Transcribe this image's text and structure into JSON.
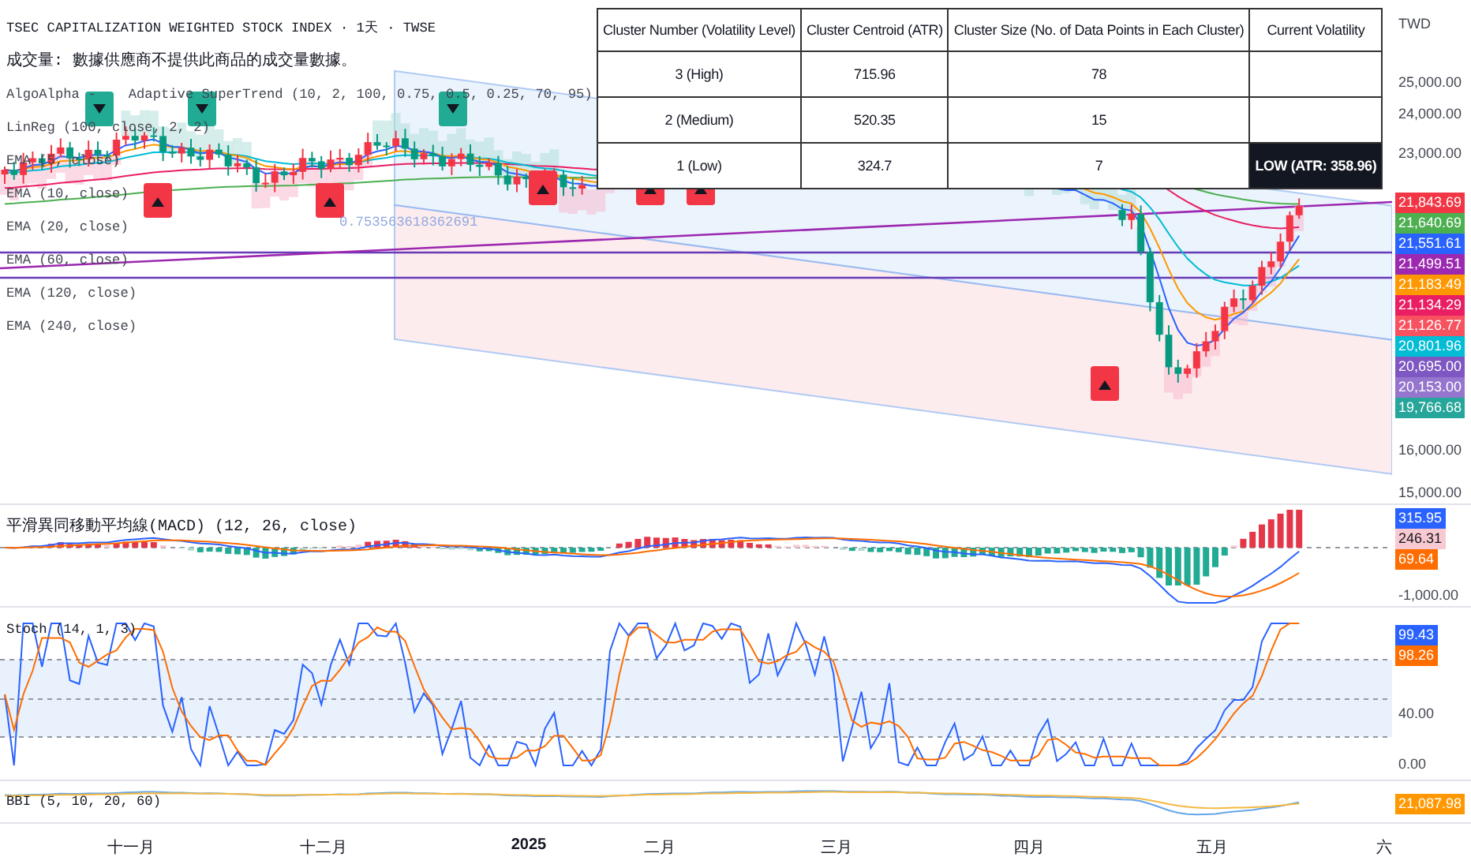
{
  "header": {
    "title": "TSEC CAPITALIZATION WEIGHTED STOCK INDEX · 1天 · TWSE",
    "volume_note": "成交量: 數據供應商不提供此商品的成交量數據。"
  },
  "indicators": [
    "AlgoAlpha -    Adaptive SuperTrend (10, 2, 100, 0.75, 0.5, 0.25, 70, 95)",
    "LinReg (100, close, 2, 2)",
    "EMA (5, close)",
    "EMA (10, close)",
    "EMA (20, close)",
    "EMA (60, close)",
    "EMA (120, close)",
    "EMA (240, close)"
  ],
  "chart_label": "0.753563618362691",
  "cluster_table": {
    "columns": [
      "Cluster Number (Volatility Level)",
      "Cluster Centroid (ATR)",
      "Cluster Size (No. of Data Points in Each Cluster)",
      "Current Volatility"
    ],
    "rows": [
      {
        "cluster": "3 (High)",
        "centroid": "715.96",
        "size": "78"
      },
      {
        "cluster": "2 (Medium)",
        "centroid": "520.35",
        "size": "15"
      },
      {
        "cluster": "1 (Low)",
        "centroid": "324.7",
        "size": "7",
        "current": "LOW (ATR: 358.96)"
      }
    ]
  },
  "price_axis": {
    "currency": "TWD",
    "ticks": [
      "25,000.00",
      "24,000.00",
      "23,000.00",
      "16,000.00",
      "15,000.00"
    ],
    "tags": [
      {
        "text": "21,843.69",
        "color": "#f23645"
      },
      {
        "text": "21,640.69",
        "color": "#4caf50"
      },
      {
        "text": "21,551.61",
        "color": "#2962ff"
      },
      {
        "text": "21,499.51",
        "color": "#9c27b0"
      },
      {
        "text": "21,183.49",
        "color": "#ff9800"
      },
      {
        "text": "21,134.29",
        "color": "#e91e63"
      },
      {
        "text": "21,126.77",
        "color": "#f7525f"
      },
      {
        "text": "20,801.96",
        "color": "#00bcd4"
      },
      {
        "text": "20,695.00",
        "color": "#7e57c2"
      },
      {
        "text": "20,153.00",
        "color": "#9575cd"
      },
      {
        "text": "19,766.68",
        "color": "#26a69a"
      }
    ]
  },
  "panes": [
    {
      "kind": "macd",
      "label": "平滑異同移動平均線(MACD) (12, 26, close)",
      "ticks": [
        "-1,000.00"
      ],
      "tags": [
        {
          "text": "315.95",
          "color": "#2962ff"
        },
        {
          "text": "246.31",
          "color": "#f8c9d0"
        },
        {
          "text": "69.64",
          "color": "#ff6d00"
        }
      ]
    },
    {
      "kind": "stoch",
      "label": "Stoch (14, 1, 3)",
      "ticks": [
        "40.00",
        "0.00"
      ],
      "tags": [
        {
          "text": "99.43",
          "color": "#2962ff"
        },
        {
          "text": "98.26",
          "color": "#ff6d00"
        }
      ]
    },
    {
      "kind": "bbi",
      "label": "BBI (5, 10, 20, 60)",
      "tags": [
        {
          "text": "21,087.98",
          "color": "#ff9800"
        }
      ]
    }
  ],
  "time_axis": [
    {
      "label": "十一月",
      "bold": false
    },
    {
      "label": "十二月",
      "bold": false
    },
    {
      "label": "2025",
      "bold": true
    },
    {
      "label": "二月",
      "bold": false
    },
    {
      "label": "三月",
      "bold": false
    },
    {
      "label": "四月",
      "bold": false
    },
    {
      "label": "五月",
      "bold": false
    },
    {
      "label": "六",
      "bold": false
    }
  ]
}
